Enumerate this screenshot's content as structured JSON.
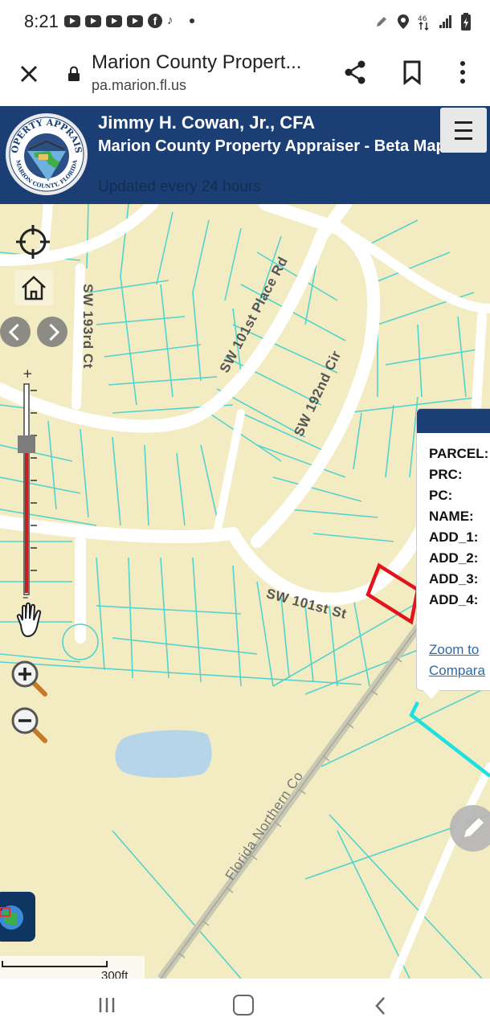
{
  "status_bar": {
    "time": "8:21",
    "notification_icons": [
      "youtube-icon",
      "youtube-icon",
      "youtube-icon",
      "youtube-icon",
      "facebook-icon",
      "tiktok-icon",
      "more-dot-icon"
    ],
    "system_icons": [
      "edit-icon",
      "location-icon",
      "data-signal-icon",
      "cell-signal-icon",
      "battery-icon"
    ]
  },
  "browser": {
    "title": "Marion County Propert...",
    "url": "pa.marion.fl.us",
    "icons": [
      "close-icon",
      "lock-icon",
      "share-icon",
      "bookmark-icon",
      "more-vert-icon"
    ]
  },
  "header": {
    "name": "Jimmy H. Cowan, Jr., CFA",
    "subtitle": "Marion County Property Appraiser - Beta MapIt+",
    "updated": "Updated every 24 hours",
    "logo_top_text": "PROPERTY APPRAISER",
    "logo_bottom_text": "MARION COUNTY, FLORIDA",
    "colors": {
      "bar": "#1b3f74"
    }
  },
  "map": {
    "road_labels": {
      "place_rd": "SW 101st Place Rd",
      "ct_193rd": "SW 193rd Ct",
      "cir_192nd": "SW 192nd Cir",
      "st_101st": "SW 101st St",
      "railroad": "Florida Northern Co"
    },
    "zoom_plus": "+",
    "zoom_minus": "–",
    "scale_label": "300ft",
    "colors": {
      "background": "#f3ecc2",
      "parcel_lines": "#52d3cf",
      "roads": "#ffffff",
      "selected_parcel": "#e0141c",
      "adjacent_parcel": "#1fe0e0",
      "water": "#b6d5e8"
    }
  },
  "popup": {
    "fields": [
      "PARCEL:",
      "PRC:",
      "PC:",
      "NAME:",
      "ADD_1:",
      "ADD_2:",
      "ADD_3:",
      "ADD_4:"
    ],
    "link_zoom": "Zoom to",
    "link_compare": "Compara"
  },
  "nav_bar": {
    "icons": [
      "recent-apps-icon",
      "home-icon",
      "back-icon"
    ]
  }
}
